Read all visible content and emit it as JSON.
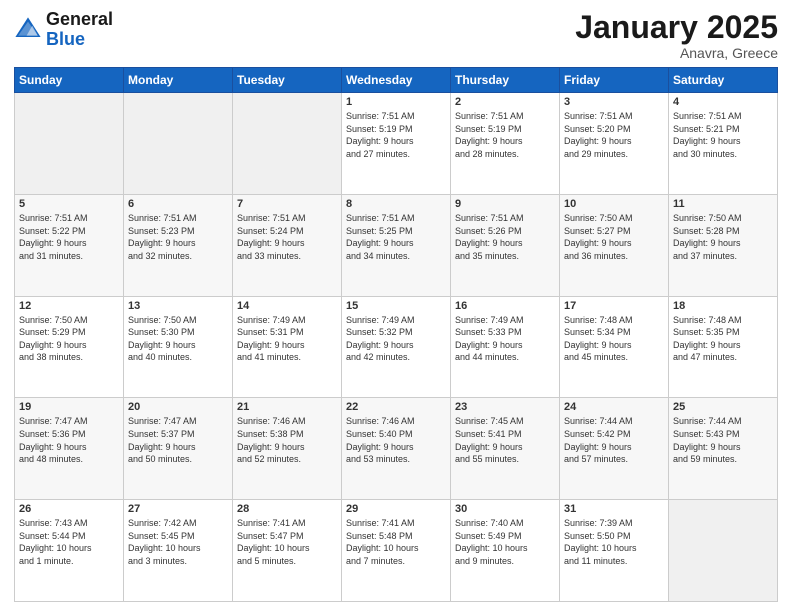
{
  "logo": {
    "line1": "General",
    "line2": "Blue"
  },
  "header": {
    "month": "January 2025",
    "location": "Anavra, Greece"
  },
  "weekdays": [
    "Sunday",
    "Monday",
    "Tuesday",
    "Wednesday",
    "Thursday",
    "Friday",
    "Saturday"
  ],
  "weeks": [
    [
      {
        "day": "",
        "content": ""
      },
      {
        "day": "",
        "content": ""
      },
      {
        "day": "",
        "content": ""
      },
      {
        "day": "1",
        "content": "Sunrise: 7:51 AM\nSunset: 5:19 PM\nDaylight: 9 hours\nand 27 minutes."
      },
      {
        "day": "2",
        "content": "Sunrise: 7:51 AM\nSunset: 5:19 PM\nDaylight: 9 hours\nand 28 minutes."
      },
      {
        "day": "3",
        "content": "Sunrise: 7:51 AM\nSunset: 5:20 PM\nDaylight: 9 hours\nand 29 minutes."
      },
      {
        "day": "4",
        "content": "Sunrise: 7:51 AM\nSunset: 5:21 PM\nDaylight: 9 hours\nand 30 minutes."
      }
    ],
    [
      {
        "day": "5",
        "content": "Sunrise: 7:51 AM\nSunset: 5:22 PM\nDaylight: 9 hours\nand 31 minutes."
      },
      {
        "day": "6",
        "content": "Sunrise: 7:51 AM\nSunset: 5:23 PM\nDaylight: 9 hours\nand 32 minutes."
      },
      {
        "day": "7",
        "content": "Sunrise: 7:51 AM\nSunset: 5:24 PM\nDaylight: 9 hours\nand 33 minutes."
      },
      {
        "day": "8",
        "content": "Sunrise: 7:51 AM\nSunset: 5:25 PM\nDaylight: 9 hours\nand 34 minutes."
      },
      {
        "day": "9",
        "content": "Sunrise: 7:51 AM\nSunset: 5:26 PM\nDaylight: 9 hours\nand 35 minutes."
      },
      {
        "day": "10",
        "content": "Sunrise: 7:50 AM\nSunset: 5:27 PM\nDaylight: 9 hours\nand 36 minutes."
      },
      {
        "day": "11",
        "content": "Sunrise: 7:50 AM\nSunset: 5:28 PM\nDaylight: 9 hours\nand 37 minutes."
      }
    ],
    [
      {
        "day": "12",
        "content": "Sunrise: 7:50 AM\nSunset: 5:29 PM\nDaylight: 9 hours\nand 38 minutes."
      },
      {
        "day": "13",
        "content": "Sunrise: 7:50 AM\nSunset: 5:30 PM\nDaylight: 9 hours\nand 40 minutes."
      },
      {
        "day": "14",
        "content": "Sunrise: 7:49 AM\nSunset: 5:31 PM\nDaylight: 9 hours\nand 41 minutes."
      },
      {
        "day": "15",
        "content": "Sunrise: 7:49 AM\nSunset: 5:32 PM\nDaylight: 9 hours\nand 42 minutes."
      },
      {
        "day": "16",
        "content": "Sunrise: 7:49 AM\nSunset: 5:33 PM\nDaylight: 9 hours\nand 44 minutes."
      },
      {
        "day": "17",
        "content": "Sunrise: 7:48 AM\nSunset: 5:34 PM\nDaylight: 9 hours\nand 45 minutes."
      },
      {
        "day": "18",
        "content": "Sunrise: 7:48 AM\nSunset: 5:35 PM\nDaylight: 9 hours\nand 47 minutes."
      }
    ],
    [
      {
        "day": "19",
        "content": "Sunrise: 7:47 AM\nSunset: 5:36 PM\nDaylight: 9 hours\nand 48 minutes."
      },
      {
        "day": "20",
        "content": "Sunrise: 7:47 AM\nSunset: 5:37 PM\nDaylight: 9 hours\nand 50 minutes."
      },
      {
        "day": "21",
        "content": "Sunrise: 7:46 AM\nSunset: 5:38 PM\nDaylight: 9 hours\nand 52 minutes."
      },
      {
        "day": "22",
        "content": "Sunrise: 7:46 AM\nSunset: 5:40 PM\nDaylight: 9 hours\nand 53 minutes."
      },
      {
        "day": "23",
        "content": "Sunrise: 7:45 AM\nSunset: 5:41 PM\nDaylight: 9 hours\nand 55 minutes."
      },
      {
        "day": "24",
        "content": "Sunrise: 7:44 AM\nSunset: 5:42 PM\nDaylight: 9 hours\nand 57 minutes."
      },
      {
        "day": "25",
        "content": "Sunrise: 7:44 AM\nSunset: 5:43 PM\nDaylight: 9 hours\nand 59 minutes."
      }
    ],
    [
      {
        "day": "26",
        "content": "Sunrise: 7:43 AM\nSunset: 5:44 PM\nDaylight: 10 hours\nand 1 minute."
      },
      {
        "day": "27",
        "content": "Sunrise: 7:42 AM\nSunset: 5:45 PM\nDaylight: 10 hours\nand 3 minutes."
      },
      {
        "day": "28",
        "content": "Sunrise: 7:41 AM\nSunset: 5:47 PM\nDaylight: 10 hours\nand 5 minutes."
      },
      {
        "day": "29",
        "content": "Sunrise: 7:41 AM\nSunset: 5:48 PM\nDaylight: 10 hours\nand 7 minutes."
      },
      {
        "day": "30",
        "content": "Sunrise: 7:40 AM\nSunset: 5:49 PM\nDaylight: 10 hours\nand 9 minutes."
      },
      {
        "day": "31",
        "content": "Sunrise: 7:39 AM\nSunset: 5:50 PM\nDaylight: 10 hours\nand 11 minutes."
      },
      {
        "day": "",
        "content": ""
      }
    ]
  ]
}
